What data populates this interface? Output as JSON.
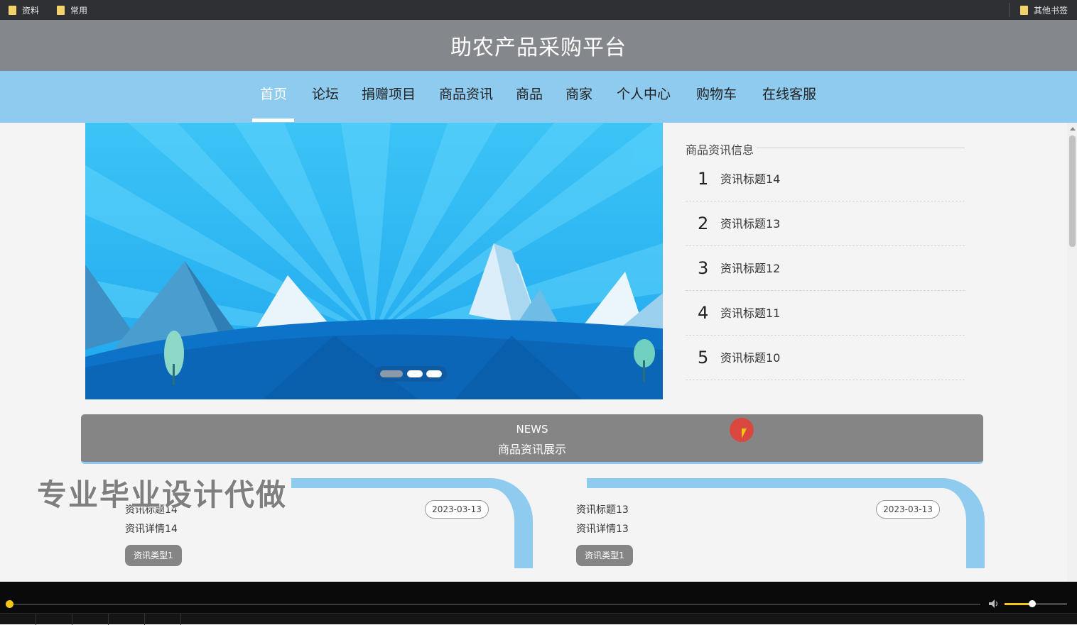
{
  "bookmarks": {
    "left": [
      {
        "label": "资料"
      },
      {
        "label": "常用"
      }
    ],
    "right": {
      "label": "其他书签"
    }
  },
  "site": {
    "title": "助农产品采购平台"
  },
  "nav": {
    "items": [
      {
        "label": "首页",
        "active": true
      },
      {
        "label": "论坛"
      },
      {
        "label": "捐赠项目"
      },
      {
        "label": "商品资讯"
      },
      {
        "label": "商品"
      },
      {
        "label": "商家"
      },
      {
        "label": "个人中心"
      },
      {
        "label": "购物车"
      },
      {
        "label": "在线客服"
      }
    ]
  },
  "side_news": {
    "title": "商品资讯信息",
    "items": [
      {
        "num": "1",
        "title": "资讯标题14"
      },
      {
        "num": "2",
        "title": "资讯标题13"
      },
      {
        "num": "3",
        "title": "资讯标题12"
      },
      {
        "num": "4",
        "title": "资讯标题11"
      },
      {
        "num": "5",
        "title": "资讯标题10"
      }
    ]
  },
  "news_section": {
    "en": "NEWS",
    "cn": "商品资讯展示"
  },
  "cards": [
    {
      "title": "资讯标题14",
      "detail": "资讯详情14",
      "date": "2023-03-13",
      "tag": "资讯类型1"
    },
    {
      "title": "资讯标题13",
      "detail": "资讯详情13",
      "date": "2023-03-13",
      "tag": "资讯类型1"
    }
  ],
  "watermark": "专业毕业设计代做",
  "colors": {
    "nav_bg": "#8ecbef",
    "title_bg": "#84878b",
    "accent": "#f5c518"
  }
}
